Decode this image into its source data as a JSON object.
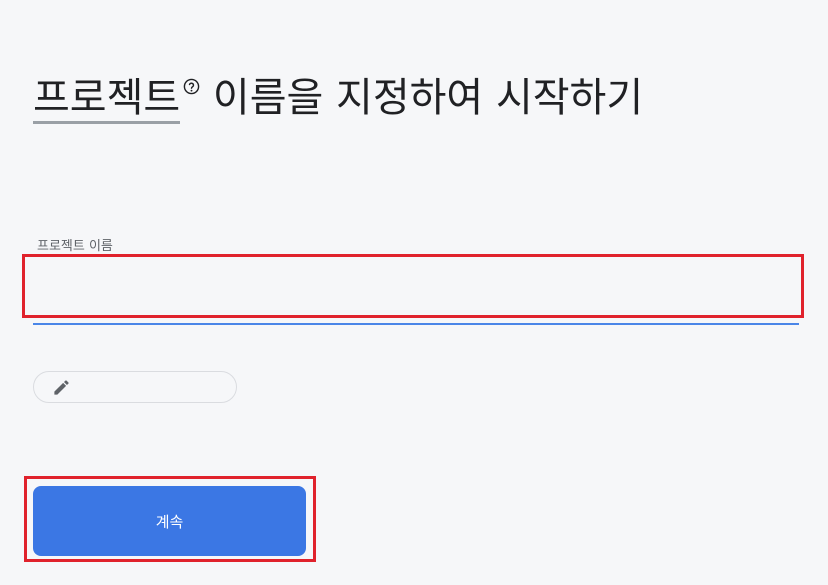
{
  "heading": {
    "term": "프로젝트",
    "rest": " 이름을 지정하여 시작하기",
    "help_icon": "help-circle-icon"
  },
  "project_name_field": {
    "label": "프로젝트 이름",
    "value": "",
    "underline_color": "#4a86e8"
  },
  "edit_chip": {
    "icon": "pencil-icon",
    "text": ""
  },
  "continue_button": {
    "label": "계속",
    "color": "#3b77e4"
  },
  "highlight_color": "#e0222c"
}
